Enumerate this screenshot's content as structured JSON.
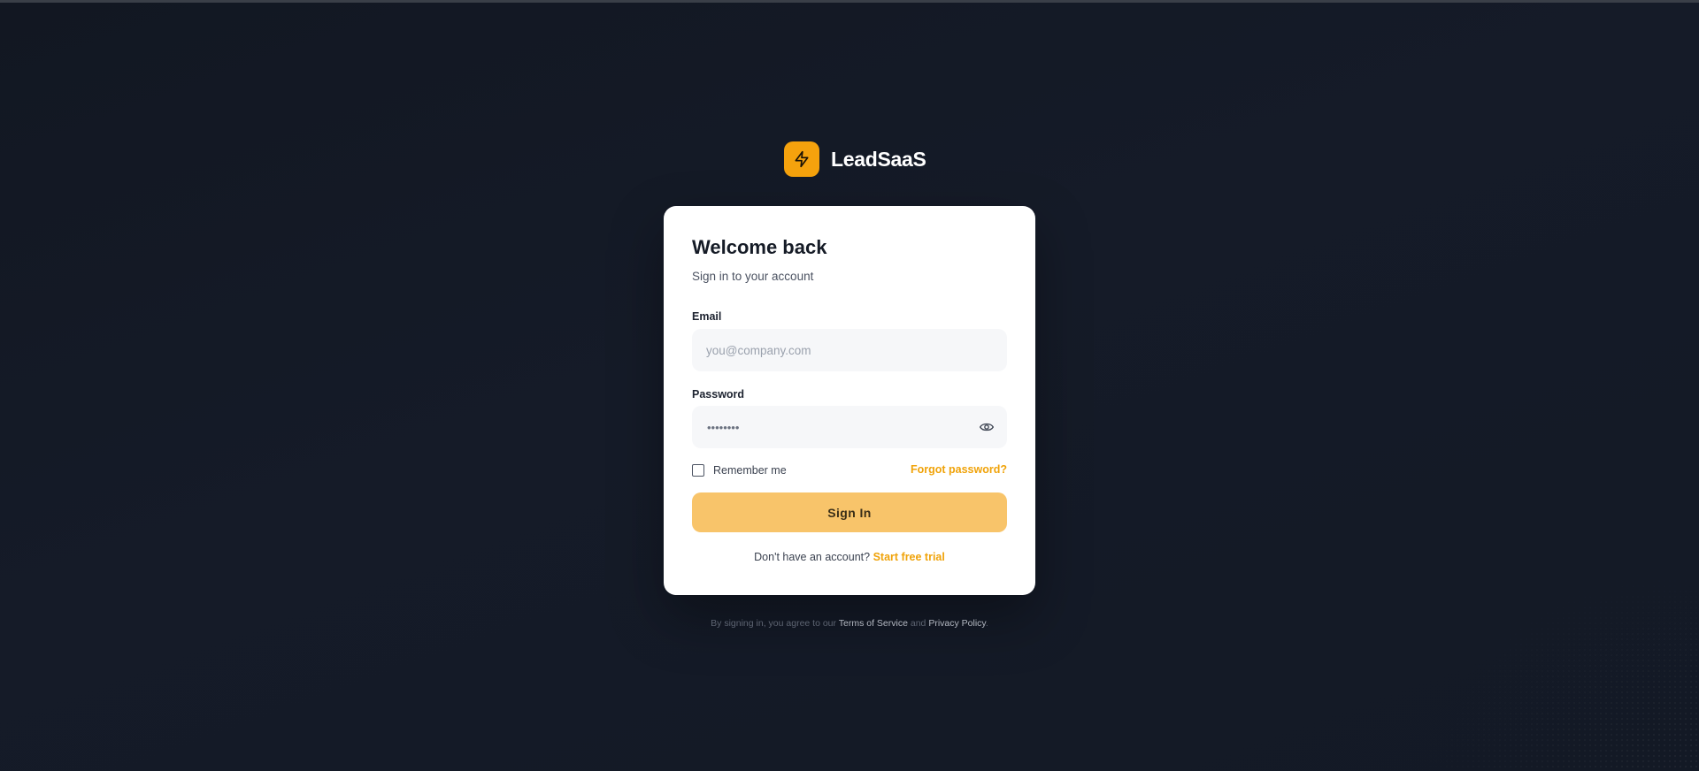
{
  "brand": {
    "name": "LeadSaaS",
    "logo_icon": "lightning-bolt-icon",
    "accent_color": "#f5a20d"
  },
  "login": {
    "title": "Welcome back",
    "subtitle": "Sign in to your account",
    "email_label": "Email",
    "email_placeholder": "you@company.com",
    "email_value": "",
    "password_label": "Password",
    "password_masked": "••••••••",
    "password_toggle_icon": "eye-icon",
    "remember_label": "Remember me",
    "remember_checked": false,
    "forgot_label": "Forgot password?",
    "submit_label": "Sign In",
    "signup_prompt": "Don't have an account?",
    "signup_link": "Start free trial"
  },
  "footer": {
    "prefix": "By signing in, you agree to our",
    "terms_link": "Terms of Service",
    "conjunction": "and",
    "privacy_link": "Privacy Policy",
    "suffix": "."
  },
  "colors": {
    "background": "#131925",
    "card": "#ffffff",
    "button": "#f8c46a",
    "link": "#f0a30a"
  }
}
